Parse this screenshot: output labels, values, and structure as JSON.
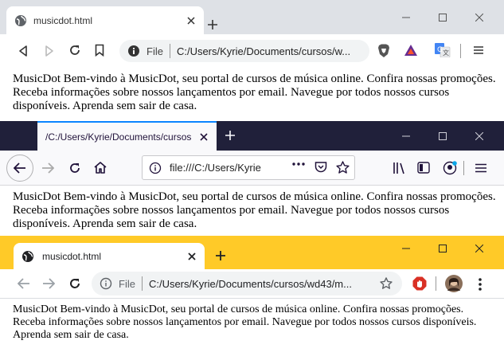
{
  "windows": [
    {
      "tab_title": "musicdot.html",
      "omnibox_label": "File",
      "url": "C:/Users/Kyrie/Documents/cursos/w...",
      "body_text": "MusicDot Bem-vindo à MusicDot, seu portal de cursos de música online. Confira nossas promoções. Receba informações sobre nossos lançamentos por email. Navegue por todos nossos cursos disponíveis. Aprenda sem sair de casa."
    },
    {
      "tab_title": "/C:/Users/Kyrie/Documents/cursos",
      "url": "file:///C:/Users/Kyrie",
      "body_text": "MusicDot Bem-vindo à MusicDot, seu portal de cursos de música online. Confira nossas promoções. Receba informações sobre nossos lançamentos por email. Navegue por todos nossos cursos disponíveis. Aprenda sem sair de casa."
    },
    {
      "tab_title": "musicdot.html",
      "omnibox_label": "File",
      "url": "C:/Users/Kyrie/Documents/cursos/wd43/m...",
      "body_text": "MusicDot Bem-vindo à MusicDot, seu portal de cursos de música online. Confira nossas promoções. Receba informações sobre nossos lançamentos por email. Navegue por todos nossos cursos disponíveis. Aprenda sem sair de casa."
    }
  ],
  "colors": {
    "brave_frame": "#dee1e6",
    "firefox_frame": "#20203a",
    "firefox_accent": "#0a84ff",
    "chrome_frame": "#ffca28"
  },
  "icons": {
    "window1": [
      "globe-icon",
      "close-icon",
      "new-tab-icon",
      "minimize-icon",
      "maximize-icon",
      "close-window-icon",
      "back-icon",
      "forward-icon",
      "reload-icon",
      "bookmark-icon",
      "info-icon",
      "brave-shield-icon",
      "brave-rewards-icon",
      "translate-icon",
      "menu-icon"
    ],
    "window2": [
      "close-icon",
      "new-tab-icon",
      "back-icon",
      "forward-icon",
      "reload-icon",
      "home-icon",
      "info-icon",
      "more-icon",
      "pocket-icon",
      "star-icon",
      "library-icon",
      "sidebar-icon",
      "account-icon",
      "menu-icon"
    ],
    "window3": [
      "globe-icon",
      "close-icon",
      "new-tab-icon",
      "back-icon",
      "forward-icon",
      "reload-icon",
      "info-icon",
      "star-icon",
      "adblock-icon",
      "profile-avatar",
      "more-icon"
    ]
  }
}
